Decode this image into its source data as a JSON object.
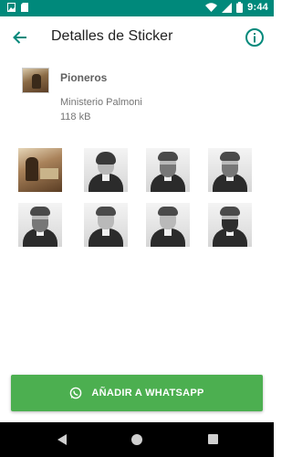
{
  "status_bar": {
    "time": "9:44"
  },
  "app_bar": {
    "title": "Detalles de Sticker"
  },
  "pack": {
    "name": "Pioneros",
    "publisher": "Ministerio Palmoni",
    "size": "118 kB"
  },
  "stickers": [
    {
      "id": 1,
      "variant": "scene"
    },
    {
      "id": 2,
      "variant": "woman"
    },
    {
      "id": 3,
      "variant": "bearded"
    },
    {
      "id": 4,
      "variant": "bearded"
    },
    {
      "id": 5,
      "variant": "bearded"
    },
    {
      "id": 6,
      "variant": "clean"
    },
    {
      "id": 7,
      "variant": "clean"
    },
    {
      "id": 8,
      "variant": "beard-dark"
    }
  ],
  "add_button": {
    "label": "AÑADIR A WHATSAPP",
    "icon": "whatsapp-icon"
  },
  "colors": {
    "status_bar": "#00897b",
    "accent": "#00897b",
    "button": "#4caf50"
  }
}
